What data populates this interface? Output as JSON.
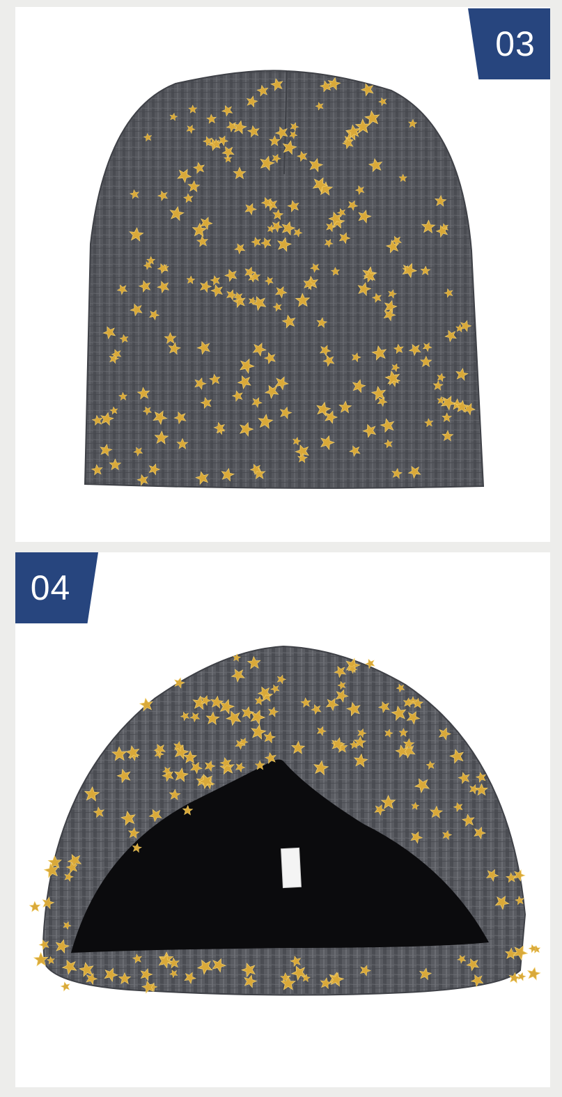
{
  "panels": [
    {
      "number": "03",
      "subject": "beanie-flat-view"
    },
    {
      "number": "04",
      "subject": "beanie-inside-view"
    }
  ],
  "colors": {
    "background": "#ededeb",
    "panel": "#ffffff",
    "badge": "#27457e",
    "badge_text": "#ffffff",
    "fabric": "#55575d",
    "fabric_dark": "#3f4147",
    "rib_light": "#6b6d73",
    "star": "#d9a93a",
    "star_light": "#f2cf6b",
    "lining": "#0b0b0d"
  }
}
